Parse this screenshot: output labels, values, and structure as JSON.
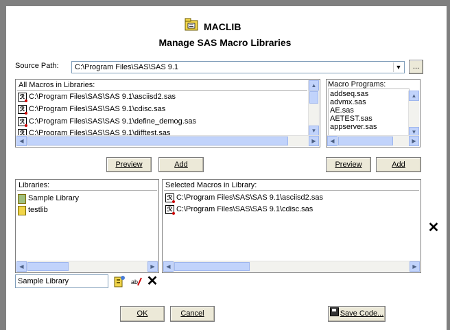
{
  "header": {
    "title": "MACLIB",
    "subtitle": "Manage SAS Macro Libraries"
  },
  "source": {
    "label": "Source Path:",
    "value": "C:\\Program Files\\SAS\\SAS 9.1",
    "browse_label": "..."
  },
  "all_macros": {
    "header": "All Macros in Libraries:",
    "items": [
      "C:\\Program Files\\SAS\\SAS 9.1\\asciisd2.sas",
      "C:\\Program Files\\SAS\\SAS 9.1\\cdisc.sas",
      "C:\\Program Files\\SAS\\SAS 9.1\\define_demog.sas",
      "C:\\Program Files\\SAS\\SAS 9.1\\difftest.sas"
    ]
  },
  "macro_programs": {
    "header": "Macro Programs:",
    "items": [
      "addseq.sas",
      "advmx.sas",
      "AE.sas",
      "AETEST.sas",
      "appserver.sas"
    ]
  },
  "buttons": {
    "preview_1": "Preview",
    "add_1": "Add",
    "preview_2": "Preview",
    "add_2": "Add",
    "ok": "OK",
    "cancel": "Cancel",
    "save_code": "Save Code..."
  },
  "libraries": {
    "header": "Libraries:",
    "items": [
      "Sample Library",
      "testlib"
    ],
    "name_value": "Sample Library"
  },
  "selected_macros": {
    "header": "Selected Macros in Library:",
    "items": [
      "C:\\Program Files\\SAS\\SAS 9.1\\asciisd2.sas",
      "C:\\Program Files\\SAS\\SAS 9.1\\cdisc.sas"
    ]
  },
  "icons": {
    "title": "folder-macro-icon",
    "sas_file": "sas-program-icon",
    "library": "library-book-icon",
    "remove": "close-x-icon",
    "save": "floppy-disk-icon"
  }
}
